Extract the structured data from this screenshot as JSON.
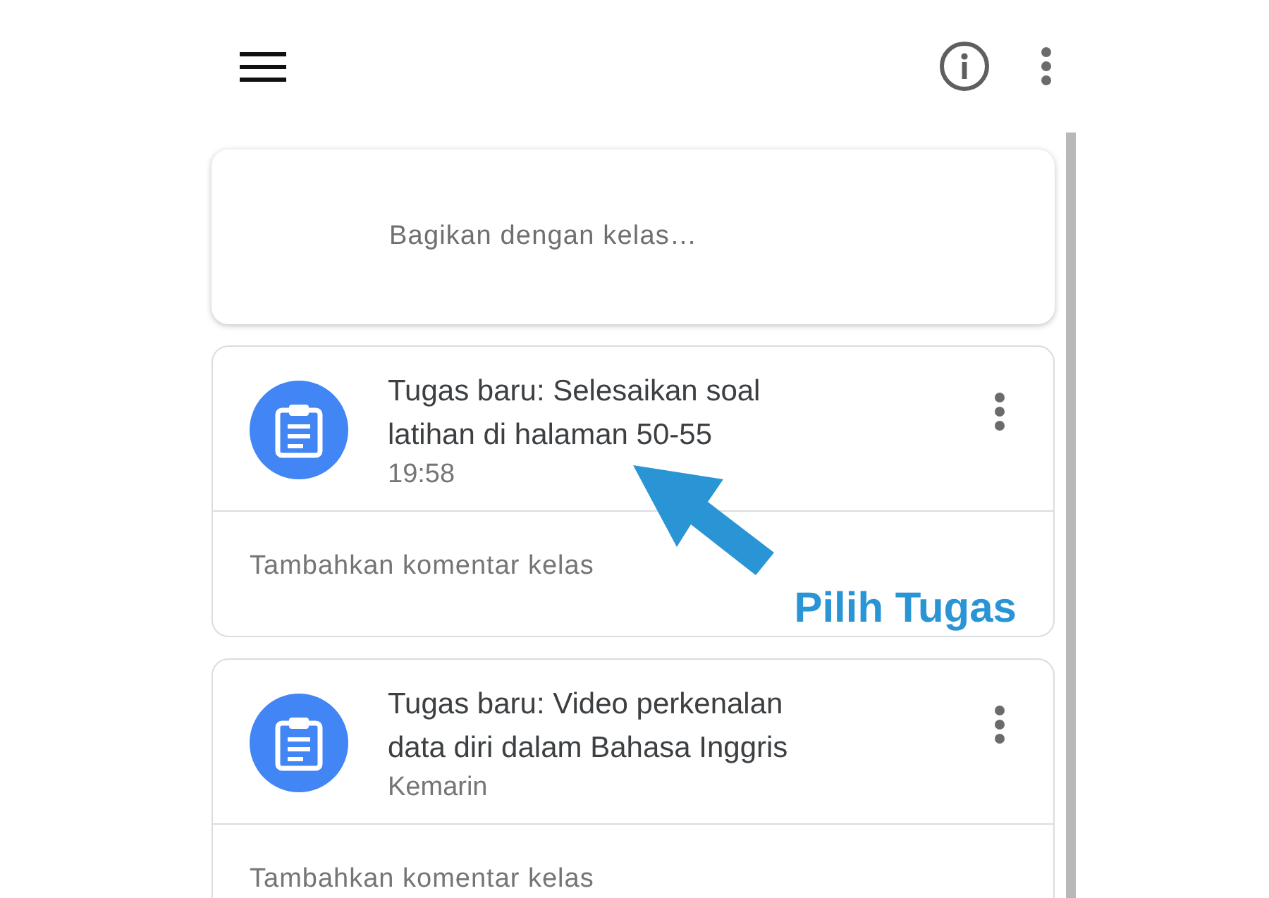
{
  "composer": {
    "placeholder": "Bagikan dengan kelas…"
  },
  "posts": [
    {
      "title": "Tugas baru: Selesaikan soal latihan di halaman 50-55",
      "time": "19:58",
      "comment_placeholder": "Tambahkan komentar kelas",
      "callout": "Pilih Tugas"
    },
    {
      "title": "Tugas baru: Video perkenalan data diri dalam Bahasa Inggris",
      "time": "Kemarin",
      "comment_placeholder": "Tambahkan komentar kelas"
    }
  ]
}
